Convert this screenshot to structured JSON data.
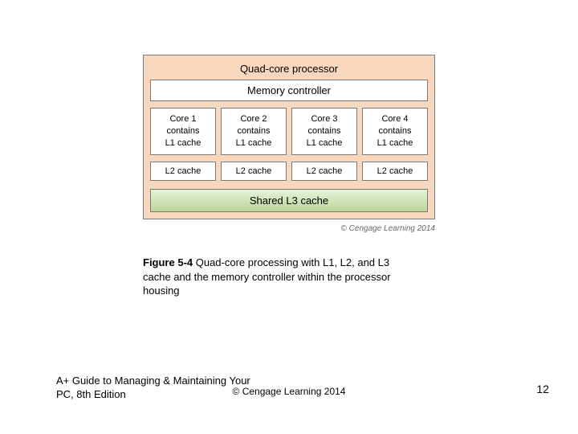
{
  "diagram": {
    "processor_title": "Quad-core processor",
    "memory_controller": "Memory controller",
    "cores": [
      {
        "name": "Core 1",
        "contains": "contains",
        "cache": "L1 cache"
      },
      {
        "name": "Core 2",
        "contains": "contains",
        "cache": "L1 cache"
      },
      {
        "name": "Core 3",
        "contains": "contains",
        "cache": "L1 cache"
      },
      {
        "name": "Core 4",
        "contains": "contains",
        "cache": "L1 cache"
      }
    ],
    "l2": [
      {
        "label": "L2 cache"
      },
      {
        "label": "L2 cache"
      },
      {
        "label": "L2 cache"
      },
      {
        "label": "L2 cache"
      }
    ],
    "l3": "Shared L3 cache",
    "small_credit": "© Cengage Learning 2014"
  },
  "caption": {
    "label": "Figure 5-4",
    "text": " Quad-core processing with L1, L2, and L3 cache and the memory controller within the processor housing"
  },
  "footer": {
    "left": "A+ Guide to Managing & Maintaining Your PC, 8th Edition",
    "center": "© Cengage Learning  2014",
    "page": "12"
  }
}
